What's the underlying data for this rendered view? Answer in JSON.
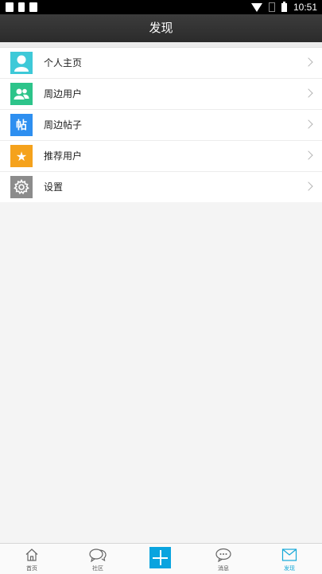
{
  "status_bar": {
    "time": "10:51"
  },
  "header": {
    "title": "发现"
  },
  "menu": {
    "items": [
      {
        "label": "个人主页",
        "icon": "user-profile-icon",
        "color": "#3ec9d8"
      },
      {
        "label": "周边用户",
        "icon": "nearby-users-icon",
        "color": "#2dc48a"
      },
      {
        "label": "周边帖子",
        "icon": "nearby-posts-icon",
        "icon_text": "帖",
        "color": "#2e8ff0"
      },
      {
        "label": "推荐用户",
        "icon": "star-icon",
        "icon_text": "★",
        "color": "#f5a21c"
      },
      {
        "label": "设置",
        "icon": "gear-icon",
        "color": "#8c8c8c"
      }
    ]
  },
  "bottom_nav": {
    "items": [
      {
        "label": "首页",
        "icon": "home-icon"
      },
      {
        "label": "社区",
        "icon": "community-icon"
      },
      {
        "label": "",
        "icon": "plus-icon"
      },
      {
        "label": "消息",
        "icon": "message-icon"
      },
      {
        "label": "发现",
        "icon": "discover-icon",
        "active": true
      }
    ],
    "active_color": "#14a8d8"
  }
}
